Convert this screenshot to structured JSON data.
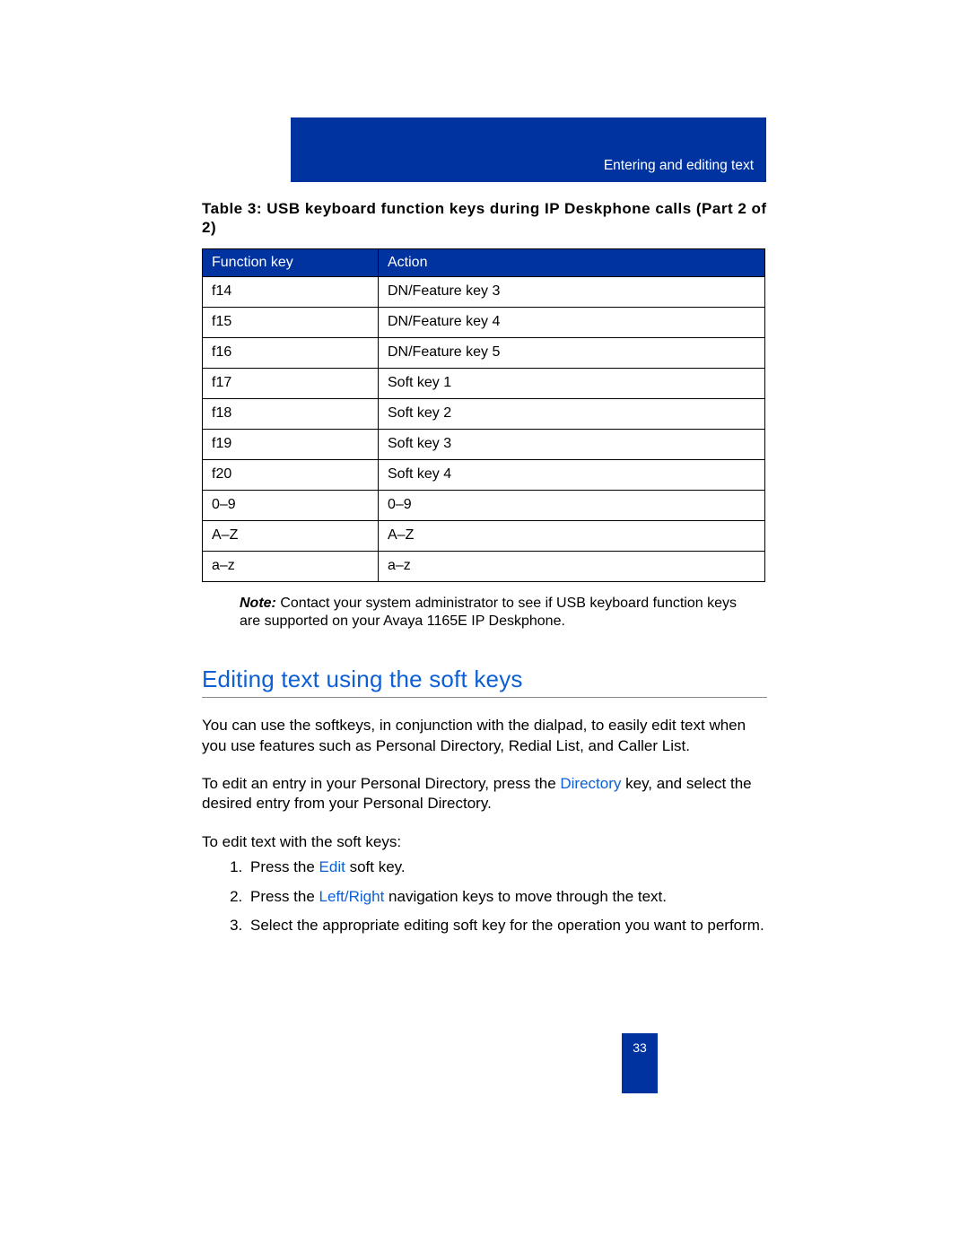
{
  "header": {
    "section_title": "Entering and editing text"
  },
  "table": {
    "title": "Table 3: USB keyboard function keys during IP Deskphone calls (Part 2 of 2)",
    "columns": [
      "Function key",
      "Action"
    ],
    "rows": [
      [
        "f14",
        "DN/Feature key 3"
      ],
      [
        "f15",
        "DN/Feature key 4"
      ],
      [
        "f16",
        "DN/Feature key 5"
      ],
      [
        "f17",
        "Soft key 1"
      ],
      [
        "f18",
        "Soft key 2"
      ],
      [
        "f19",
        "Soft key 3"
      ],
      [
        "f20",
        "Soft key 4"
      ],
      [
        "0–9",
        "0–9"
      ],
      [
        "A–Z",
        "A–Z"
      ],
      [
        "a–z",
        "a–z"
      ]
    ]
  },
  "note": {
    "label": "Note:",
    "text": " Contact your system administrator to see if USB keyboard function keys are supported on your Avaya 1165E IP Deskphone."
  },
  "section": {
    "heading": "Editing text using the soft keys",
    "para1": "You can use the softkeys, in conjunction with the dialpad, to easily edit text when you use features such as Personal Directory, Redial List, and Caller List.",
    "para2_pre": "To edit an entry in your Personal Directory, press the ",
    "para2_key": "Directory",
    "para2_post": "  key, and select the desired entry from your Personal Directory.",
    "para3": "To edit text with the soft keys:",
    "steps": {
      "s1_pre": "Press the ",
      "s1_key": "Edit",
      "s1_post": " soft key.",
      "s2_pre": "Press the ",
      "s2_key": "Left/Right",
      "s2_post": "  navigation keys to move through the text.",
      "s3": "Select the appropriate editing soft key for the operation you want to perform."
    }
  },
  "page_number": "33"
}
